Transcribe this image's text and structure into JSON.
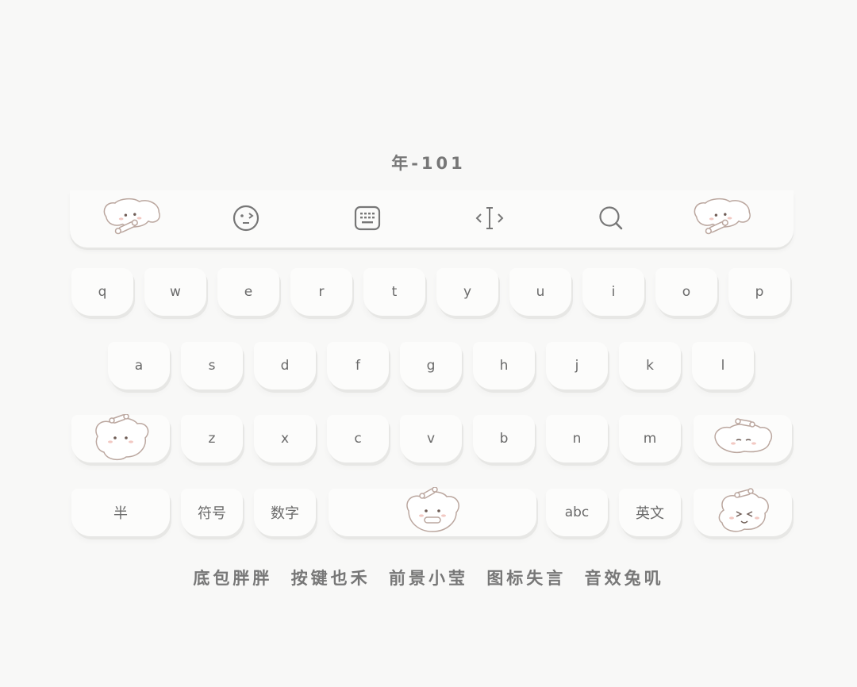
{
  "theme": {
    "title": "年-101"
  },
  "toolbar": {
    "items": [
      {
        "icon": "puppy-bone-icon"
      },
      {
        "icon": "emoji-face-icon"
      },
      {
        "icon": "keyboard-icon"
      },
      {
        "icon": "text-cursor-icon"
      },
      {
        "icon": "search-icon"
      },
      {
        "icon": "puppy-bone-icon"
      }
    ]
  },
  "keys": {
    "row1": [
      "q",
      "w",
      "e",
      "r",
      "t",
      "y",
      "u",
      "i",
      "o",
      "p"
    ],
    "row2": [
      "a",
      "s",
      "d",
      "f",
      "g",
      "h",
      "j",
      "k",
      "l"
    ],
    "row3": [
      "z",
      "x",
      "c",
      "v",
      "b",
      "n",
      "m"
    ],
    "row4": {
      "half": "半",
      "symbols": "符号",
      "numbers": "数字",
      "abc": "abc",
      "english": "英文"
    }
  },
  "credits": [
    "底包胖胖",
    "按键也禾",
    "前景小莹",
    "图标失言",
    "音效兔叽"
  ],
  "colors": {
    "background": "#f8f8f7",
    "key": "#fcfcfb",
    "key_shadow": "#e7e7e5",
    "text": "#6a6a6a",
    "dog_outline": "#bba79f"
  }
}
